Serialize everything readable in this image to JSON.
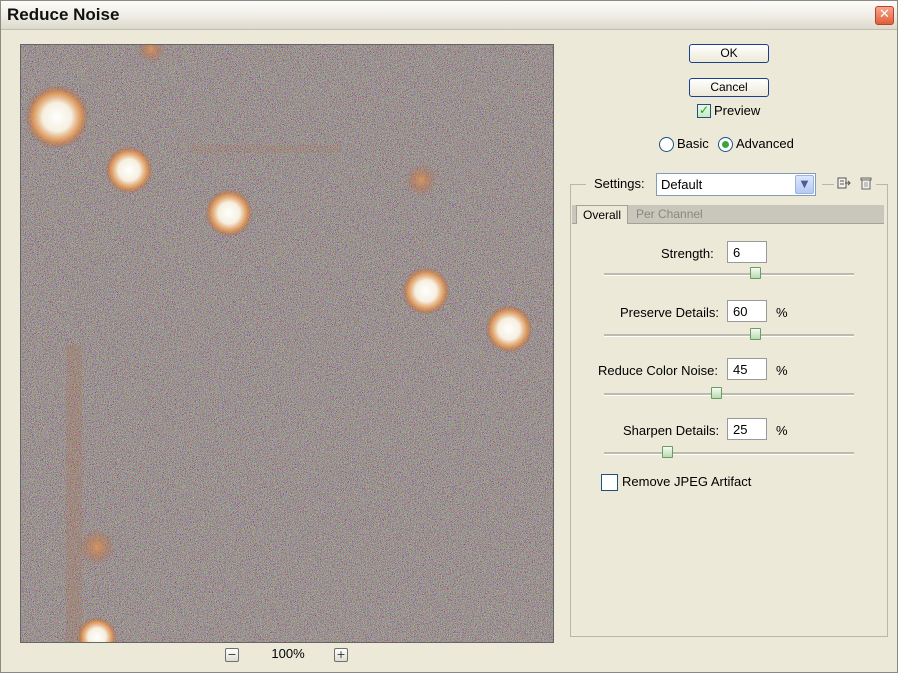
{
  "window": {
    "title": "Reduce Noise"
  },
  "preview": {
    "zoom_level": "100%",
    "zoom_out_symbol": "−",
    "zoom_in_symbol": "+"
  },
  "buttons": {
    "ok": "OK",
    "cancel": "Cancel"
  },
  "preview_toggle": {
    "label": "Preview",
    "checked": true
  },
  "mode": {
    "basic_label": "Basic",
    "advanced_label": "Advanced",
    "selected": "Advanced"
  },
  "settings": {
    "label": "Settings:",
    "selected": "Default",
    "tabs": [
      {
        "label": "Overall",
        "active": true
      },
      {
        "label": "Per Channel",
        "active": false
      }
    ]
  },
  "controls": {
    "strength": {
      "label": "Strength:",
      "value": "6",
      "max": 10
    },
    "preserve_details": {
      "label": "Preserve Details:",
      "value": "60",
      "unit": "%",
      "max": 100
    },
    "reduce_color_noise": {
      "label": "Reduce Color Noise:",
      "value": "45",
      "unit": "%",
      "max": 100
    },
    "sharpen_details": {
      "label": "Sharpen Details:",
      "value": "25",
      "unit": "%",
      "max": 100
    }
  },
  "jpeg": {
    "label": "Remove JPEG Artifact",
    "checked": false
  },
  "colors": {
    "accent_green": "#3aa53a",
    "close_red": "#e25e3b",
    "dialog_bg": "#ece9d8"
  }
}
